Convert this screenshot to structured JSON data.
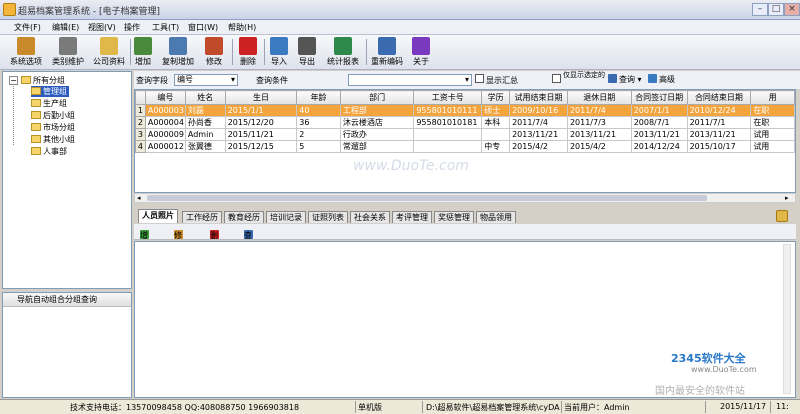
{
  "window": {
    "title": "超易档案管理系统 - [电子档案管理]"
  },
  "menu": [
    "文件(F)",
    "编辑(E)",
    "视图(V)",
    "操作",
    "工具(T)",
    "窗口(W)",
    "帮助(H)"
  ],
  "toolbar": [
    {
      "label": "系统选项",
      "icon": "hammer-icon",
      "color": "#c98a2b"
    },
    {
      "label": "类别维护",
      "icon": "tools-icon",
      "color": "#7a7a7a"
    },
    {
      "label": "公司资料",
      "icon": "folder-icon",
      "color": "#e0b84a"
    },
    {
      "label": "增加",
      "icon": "add-user-icon",
      "color": "#4a8a3c"
    },
    {
      "label": "复制增加",
      "icon": "copy-add-icon",
      "color": "#4a7ab0"
    },
    {
      "label": "修改",
      "icon": "pencil-icon",
      "color": "#c04a2a"
    },
    {
      "label": "删除",
      "icon": "delete-x-icon",
      "color": "#cc2222"
    },
    {
      "label": "导入",
      "icon": "import-icon",
      "color": "#3a7ac0"
    },
    {
      "label": "导出",
      "icon": "print-export-icon",
      "color": "#555555"
    },
    {
      "label": "统计报表",
      "icon": "bar-chart-icon",
      "color": "#2e8a4a"
    },
    {
      "label": "重新编码",
      "icon": "renumber-icon",
      "color": "#3a6ab0"
    },
    {
      "label": "关于",
      "icon": "question-icon",
      "color": "#7a3ac0"
    }
  ],
  "tree": {
    "root": "所有分组",
    "children": [
      "管理组",
      "生产组",
      "后勤小组",
      "市场分组",
      "其他小组",
      "人事部"
    ],
    "selected": "管理组"
  },
  "left_bottom": {
    "header": "导航自动组合分组查询"
  },
  "query": {
    "field_label": "查询字段",
    "field_value": "编号",
    "cond_label": "查询条件",
    "cond_value": "",
    "show_summary": "显示汇总",
    "only_show_selected": "仅显示选定的",
    "query_button": "查询",
    "advanced_button": "高级"
  },
  "grid": {
    "columns": [
      "编号",
      "姓名",
      "生日",
      "年龄",
      "部门",
      "工资卡号",
      "学历",
      "试用结束日期",
      "退休日期",
      "合同签订日期",
      "合同结束日期",
      "用"
    ],
    "rows": [
      [
        "A000003",
        "刘磊",
        "2015/1/1",
        "40",
        "工程部",
        "955801010111",
        "硕士",
        "2009/10/16",
        "2011/7/4",
        "2007/1/1",
        "2010/12/24",
        "在职"
      ],
      [
        "A000004",
        "孙尚香",
        "2015/12/20",
        "36",
        "沐云楼酒店",
        "955801010181",
        "本科",
        "2011/7/4",
        "2011/7/3",
        "2008/7/1",
        "2011/7/1",
        "在职"
      ],
      [
        "A000009",
        "Admin",
        "2015/11/21",
        "2",
        "行政办",
        "",
        "",
        "2013/11/21",
        "2013/11/21",
        "2013/11/21",
        "2013/11/21",
        "试用"
      ],
      [
        "A000012",
        "张翼德",
        "2015/12/15",
        "5",
        "常遛部",
        "",
        "中专",
        "2015/4/2",
        "2015/4/2",
        "2014/12/24",
        "2015/10/17",
        "试用"
      ]
    ],
    "selected_row": 0
  },
  "tabs": [
    "人员照片",
    "工作经历",
    "教育经历",
    "培训记录",
    "证照列表",
    "社会关系",
    "考评管理",
    "奖惩管理",
    "物品领用"
  ],
  "active_tab": 0,
  "subbar": [
    {
      "label": "增加",
      "icon": "add-icon",
      "color": "#3a9a3a"
    },
    {
      "label": "修改",
      "icon": "edit-icon",
      "color": "#c98a2b"
    },
    {
      "label": "删除",
      "icon": "delete-icon",
      "color": "#cc2222"
    },
    {
      "label": "查看",
      "icon": "view-icon",
      "color": "#3a6ab0"
    }
  ],
  "status": {
    "support": "技术支持电话：13570098458 QQ:408088750 1966903818",
    "edition": "单机版",
    "path": "D:\\超易软件\\超易档案管理系统\\cyDAData.sys",
    "user": "当前用户：Admin",
    "date": "2015/11/17",
    "time": "11:"
  },
  "watermarks": {
    "top": "www.DuoTe.com",
    "logo": "2345软件大全",
    "site": "www.DuoTe.com",
    "slogan": "国内最安全的软件站"
  }
}
